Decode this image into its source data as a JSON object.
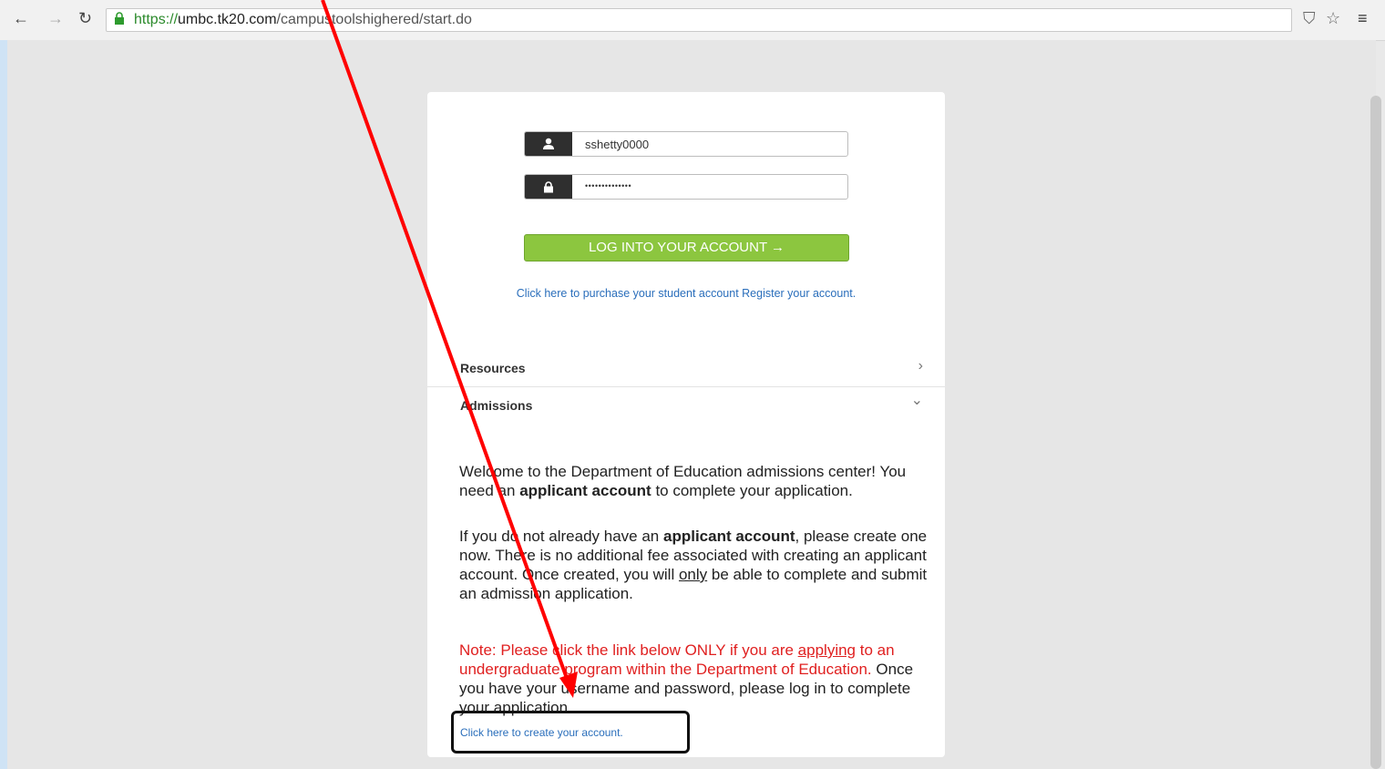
{
  "browser": {
    "url_protocol": "https://",
    "url_host": "umbc.tk20.com",
    "url_path": "/campustoolshighered/start.do"
  },
  "login": {
    "username_value": "sshetty0000",
    "password_value": "••••••••••••••",
    "login_button_label": "LOG INTO YOUR ACCOUNT",
    "login_button_arrow": "→",
    "purchase_link": "Click here to purchase your student account",
    "register_link": "Register your account."
  },
  "accordion": {
    "resources_label": "Resources",
    "resources_chevron": "›",
    "admissions_label": "Admissions",
    "admissions_chevron": "⌄"
  },
  "admissions": {
    "p1_a": "Welcome to the Department of Education admissions center! You need an ",
    "p1_bold": "applicant account",
    "p1_b": " to complete your application.",
    "p2_a": "If you do not already have an ",
    "p2_bold": "applicant account",
    "p2_b": ", please create one now. There is no additional fee associated with creating an applicant account. Once created, you will ",
    "p2_underline": "only",
    "p2_c": " be able to complete and submit an admission application.",
    "note_a": "Note: Please click the link below ONLY if you are ",
    "note_underline": "applying",
    "note_b": " to an undergraduate program within the Department of Education.",
    "note_c": " Once you have your username and password, please log in to complete your application.",
    "create_link": "Click here to create your account."
  },
  "colors": {
    "login_button": "#8cc63f",
    "link": "#2a6ebb",
    "note_text": "#e02020",
    "annotation_arrow": "#ff0000"
  }
}
